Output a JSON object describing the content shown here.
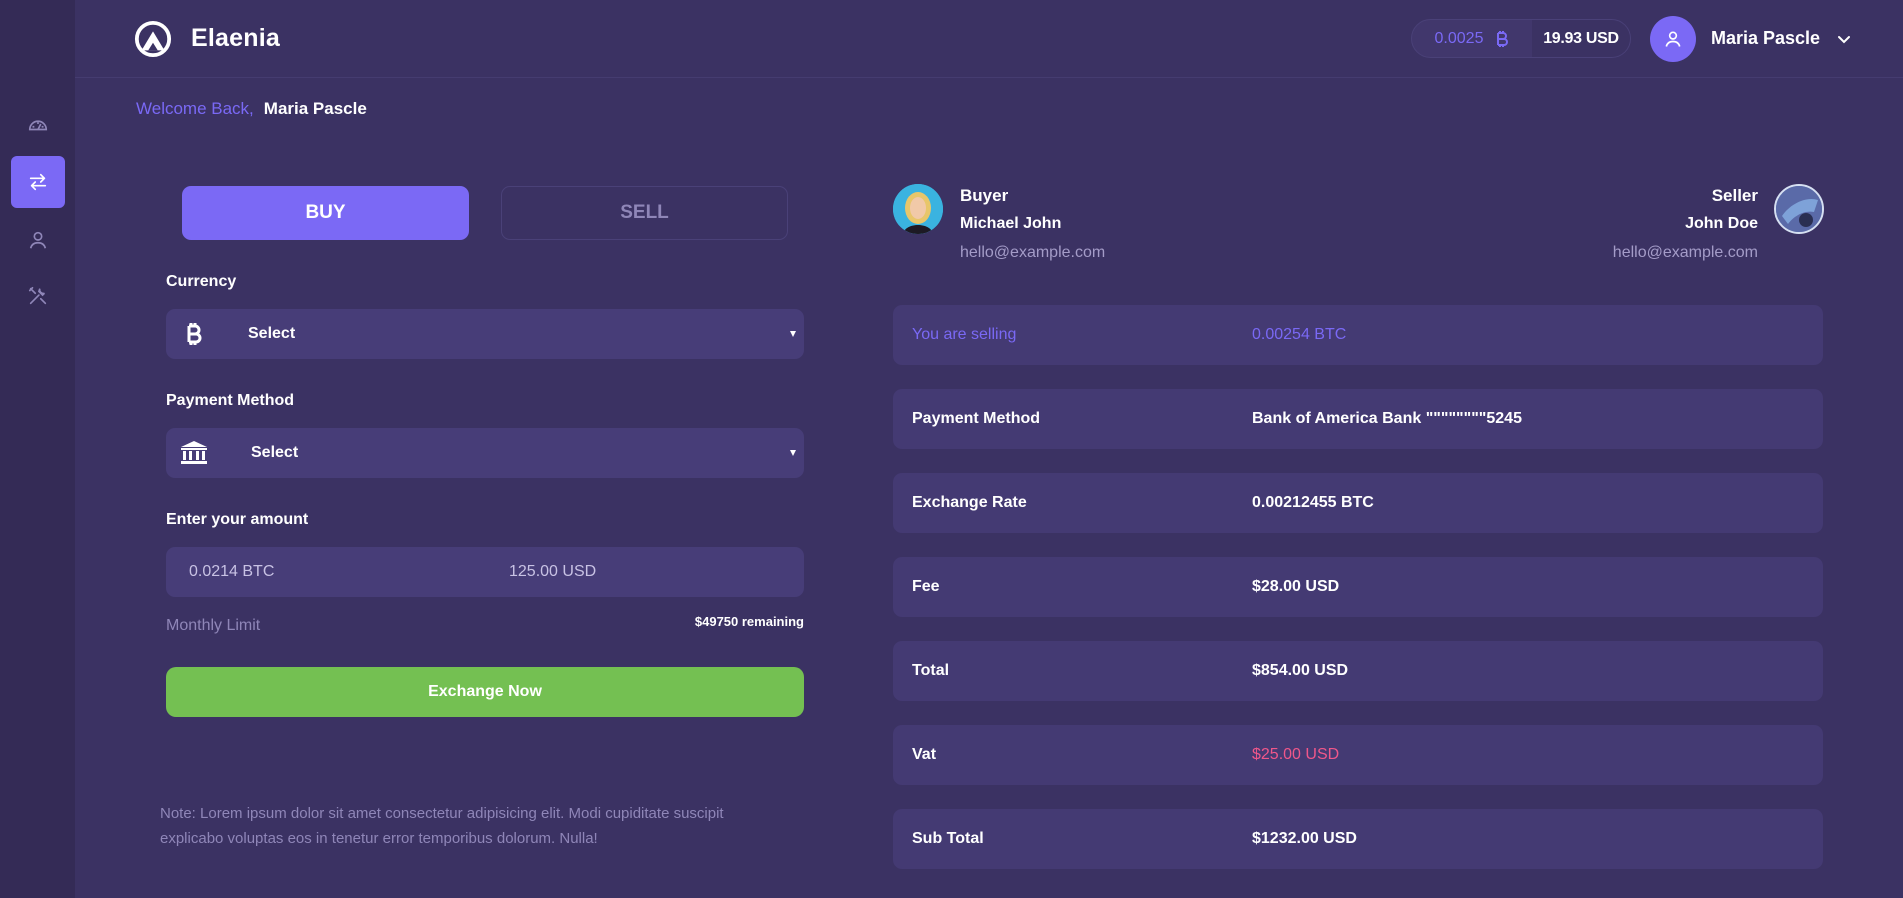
{
  "app": {
    "name": "Elaenia"
  },
  "header": {
    "balance_btc": "0.0025",
    "balance_usd": "19.93 USD",
    "user_name": "Maria Pascle"
  },
  "welcome": {
    "greeting": "Welcome Back,",
    "name": "Maria Pascle"
  },
  "sidebar": {
    "items": [
      {
        "name": "dashboard",
        "icon": "dashboard-icon",
        "active": false
      },
      {
        "name": "exchange",
        "icon": "exchange-arrows-icon",
        "active": true
      },
      {
        "name": "profile",
        "icon": "user-icon",
        "active": false
      },
      {
        "name": "settings",
        "icon": "tools-icon",
        "active": false
      }
    ]
  },
  "trade": {
    "tabs": {
      "buy": "BUY",
      "sell": "SELL",
      "active": "buy"
    },
    "currency": {
      "label": "Currency",
      "value": "Select",
      "icon": "bitcoin-icon"
    },
    "payment": {
      "label": "Payment Method",
      "value": "Select",
      "icon": "bank-icon"
    },
    "amount": {
      "label": "Enter your amount",
      "btc": "0.0214 BTC",
      "usd": "125.00 USD"
    },
    "limit": {
      "label": "Monthly Limit",
      "value": "$49750 remaining"
    },
    "submit_label": "Exchange Now",
    "note": "Note: Lorem ipsum dolor sit amet consectetur adipisicing elit. Modi cupiditate suscipit explicabo voluptas eos in tenetur error temporibus dolorum. Nulla!"
  },
  "parties": {
    "buyer": {
      "role": "Buyer",
      "name": "Michael John",
      "email": "hello@example.com"
    },
    "seller": {
      "role": "Seller",
      "name": "John Doe",
      "email": "hello@example.com"
    }
  },
  "summary": [
    {
      "key": "You are selling",
      "value": "0.00254 BTC"
    },
    {
      "key": "Payment Method",
      "value": "Bank of America Bank \"\"\"\"\"\"\"\"5245"
    },
    {
      "key": "Exchange Rate",
      "value": "0.00212455 BTC"
    },
    {
      "key": "Fee",
      "value": "$28.00 USD"
    },
    {
      "key": "Total",
      "value": "$854.00 USD"
    },
    {
      "key": "Vat",
      "value": "$25.00 USD"
    },
    {
      "key": "Sub Total",
      "value": "$1232.00 USD"
    }
  ],
  "colors": {
    "background": "#3b3263",
    "sidebar": "#342b56",
    "accent": "#7b69f5",
    "success": "#74c052",
    "danger": "#f0578a",
    "panel": "#473d78"
  }
}
